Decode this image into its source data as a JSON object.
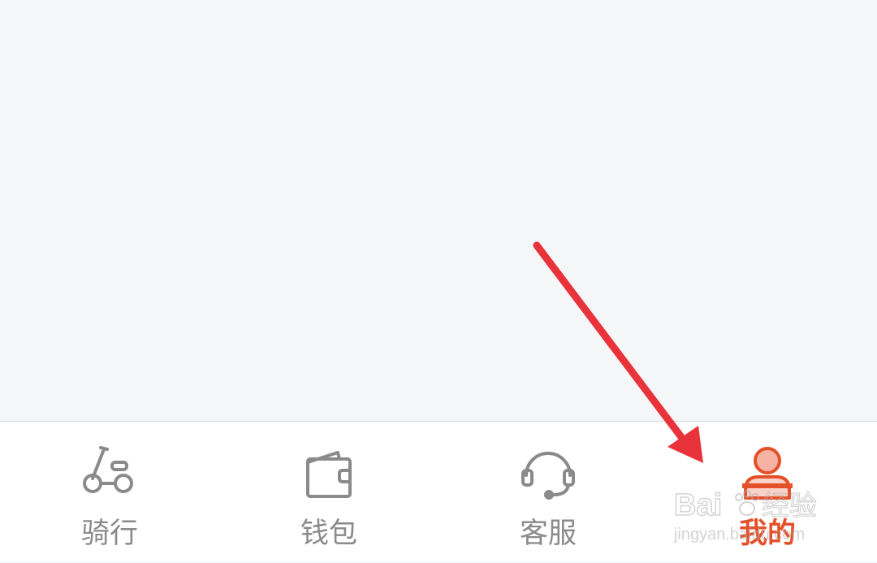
{
  "tabs": [
    {
      "id": "ride",
      "label": "骑行",
      "icon": "scooter-icon",
      "active": false
    },
    {
      "id": "wallet",
      "label": "钱包",
      "icon": "wallet-icon",
      "active": false
    },
    {
      "id": "service",
      "label": "客服",
      "icon": "headset-icon",
      "active": false
    },
    {
      "id": "mine",
      "label": "我的",
      "icon": "person-icon",
      "active": true
    }
  ],
  "colors": {
    "background": "#f5f6f8",
    "tab_inactive": "#8a8a8a",
    "tab_active": "#e4502a",
    "annotation_arrow": "#e8333a"
  },
  "watermark": {
    "brand": "Bai",
    "brand_tail": "经验",
    "url": "jingyan.baidu.com"
  }
}
